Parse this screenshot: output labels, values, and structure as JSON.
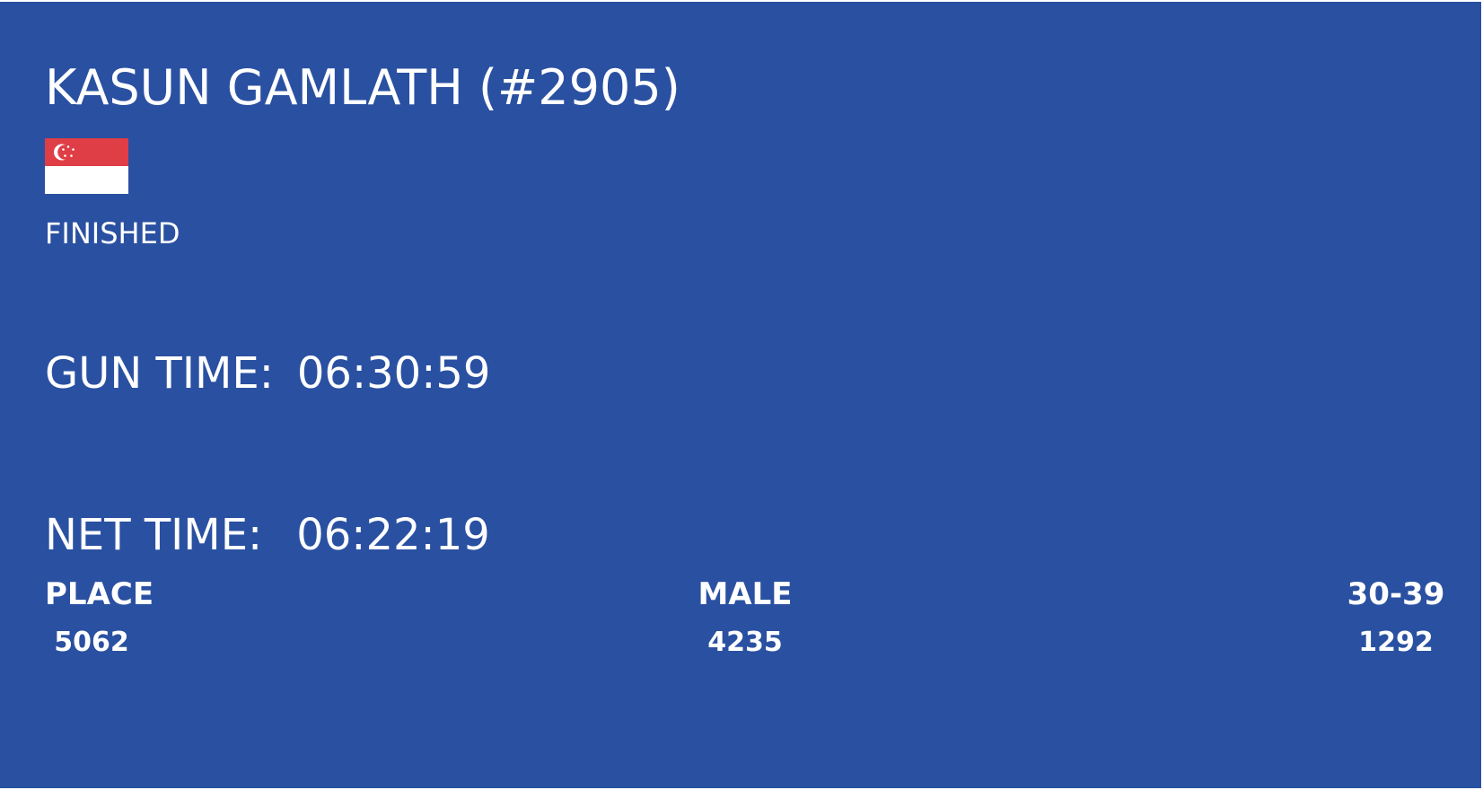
{
  "runner": {
    "name": "KASUN GAMLATH (#2905)",
    "flag_icon": "singapore-flag-icon",
    "status": "FINISHED"
  },
  "times": {
    "gun_label": "GUN TIME:",
    "gun_value": "06:30:59",
    "net_label": "NET TIME:",
    "net_value": "06:22:19"
  },
  "ranks": {
    "place_label": "PLACE",
    "place_value": "5062",
    "gender_label": "MALE",
    "gender_value": "4235",
    "age_label": "30-39",
    "age_value": "1292"
  },
  "colors": {
    "background": "#2a50a1",
    "text": "#ffffff",
    "flag_red": "#df3e46",
    "flag_white": "#ffffff"
  }
}
